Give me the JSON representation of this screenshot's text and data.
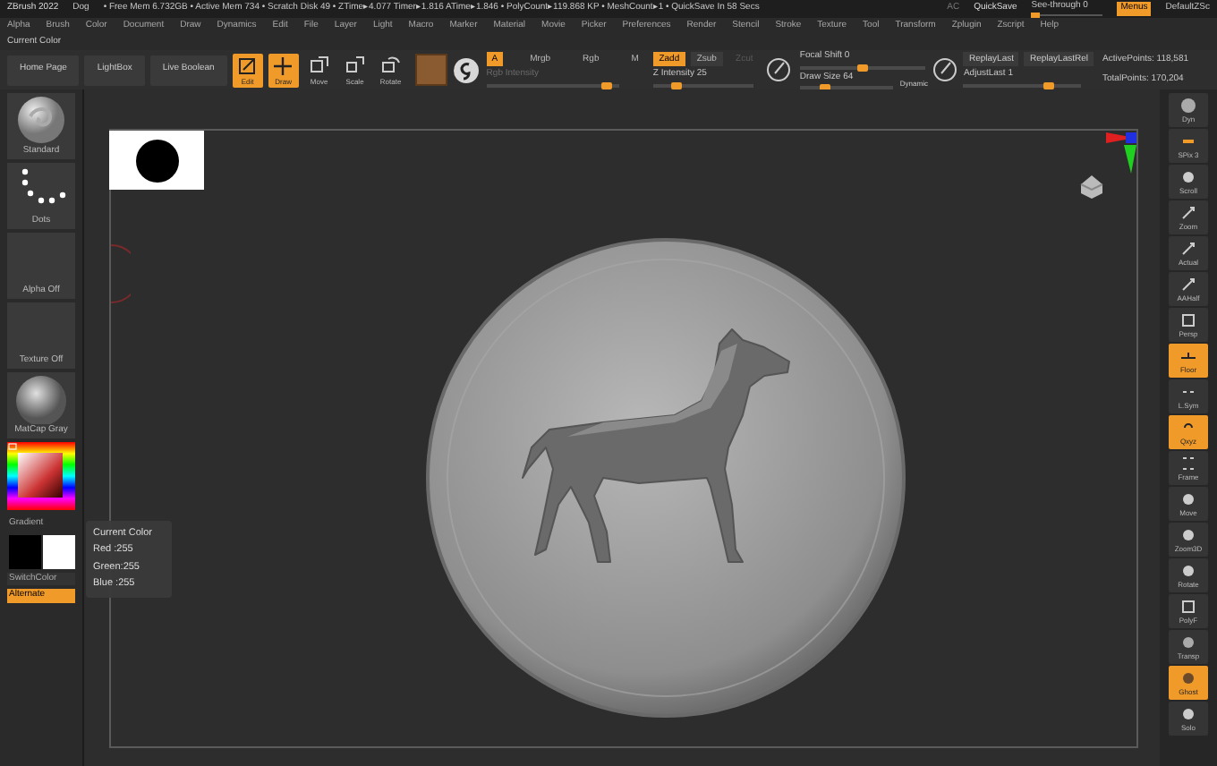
{
  "title_bar": {
    "app": "ZBrush 2022",
    "document": "Dog",
    "info": "• Free Mem 6.732GB • Active Mem 734 • Scratch Disk 49 • ZTime▸4.077 Timer▸1.816 ATime▸1.846 • PolyCount▸119.868 KP • MeshCount▸1 • QuickSave In 58 Secs",
    "ac": "AC",
    "quicksave": "QuickSave",
    "see_through": {
      "label": "See-through  0",
      "level": 0
    },
    "menus": {
      "label": "Menus",
      "selected": true
    },
    "script": "DefaultZSc"
  },
  "menu_bar": [
    "Alpha",
    "Brush",
    "Color",
    "Document",
    "Draw",
    "Dynamics",
    "Edit",
    "File",
    "Layer",
    "Light",
    "Macro",
    "Marker",
    "Material",
    "Movie",
    "Picker",
    "Preferences",
    "Render",
    "Stencil",
    "Stroke",
    "Texture",
    "Tool",
    "Transform",
    "Zplugin",
    "Zscript",
    "Help"
  ],
  "palette_title": "Current Color",
  "toolbar": {
    "buttons": [
      {
        "label": "Home Page"
      },
      {
        "label": "LightBox"
      },
      {
        "label": "Live Boolean"
      }
    ],
    "modes": [
      {
        "label": "Edit",
        "selected": true
      },
      {
        "label": "Draw",
        "selected": true
      },
      {
        "label": "Move",
        "selected": false
      },
      {
        "label": "Scale",
        "selected": false
      },
      {
        "label": "Rotate",
        "selected": false
      }
    ],
    "color_modes": [
      {
        "label": "A",
        "selected": true
      },
      {
        "label": "Mrgb",
        "selected": false
      },
      {
        "label": "Rgb",
        "selected": false
      },
      {
        "label": "M",
        "selected": false
      }
    ],
    "rgb_intensity": {
      "label": "Rgb Intensity",
      "disabled": true,
      "level": 0.95
    },
    "z_modes": [
      {
        "label": "Zadd",
        "selected": true,
        "disabled": false
      },
      {
        "label": "Zsub",
        "selected": false,
        "disabled": false
      },
      {
        "label": "Zcut",
        "selected": false,
        "disabled": true
      }
    ],
    "z_intensity": {
      "label": "Z Intensity 25",
      "level": 0.2
    },
    "focal_shift": {
      "label": "Focal Shift 0",
      "level": 0.5
    },
    "draw_size": {
      "label": "Draw Size 64",
      "level": 0.25
    },
    "dynamic": "Dynamic",
    "replay": [
      "ReplayLast",
      "ReplayLastRel"
    ],
    "adjust_last": {
      "label": "AdjustLast 1",
      "level": 0.75
    },
    "active_points": "ActivePoints: 118,581",
    "total_points": "TotalPoints: 170,204"
  },
  "left_panel": {
    "brush": "Standard",
    "stroke": "Dots",
    "alpha": "Alpha Off",
    "texture": "Texture Off",
    "material": "MatCap Gray",
    "gradient": "Gradient",
    "switch_color": "SwitchColor",
    "alternate": {
      "label": "Alternate",
      "selected": true
    }
  },
  "color_tooltip": {
    "title": "Current Color",
    "lines": [
      "Red :255",
      "Green:255",
      "Blue :255"
    ]
  },
  "right_shelf": [
    {
      "label": "Dyn",
      "selected": false
    },
    {
      "label": "SPix 3",
      "selected": false
    },
    {
      "label": "Scroll",
      "selected": false
    },
    {
      "label": "Zoom",
      "selected": false
    },
    {
      "label": "Actual",
      "selected": false
    },
    {
      "label": "AAHalf",
      "selected": false
    },
    {
      "label": "Persp",
      "selected": false
    },
    {
      "label": "Floor",
      "selected": true
    },
    {
      "label": "L.Sym",
      "selected": false
    },
    {
      "label": "Qxyz",
      "selected": true
    },
    {
      "label": "Frame",
      "selected": false
    },
    {
      "label": "Move",
      "selected": false
    },
    {
      "label": "Zoom3D",
      "selected": false
    },
    {
      "label": "Rotate",
      "selected": false
    },
    {
      "label": "PolyF",
      "selected": false
    },
    {
      "label": "Transp",
      "selected": false
    },
    {
      "label": "Ghost",
      "selected": true
    },
    {
      "label": "Solo",
      "selected": false
    }
  ]
}
